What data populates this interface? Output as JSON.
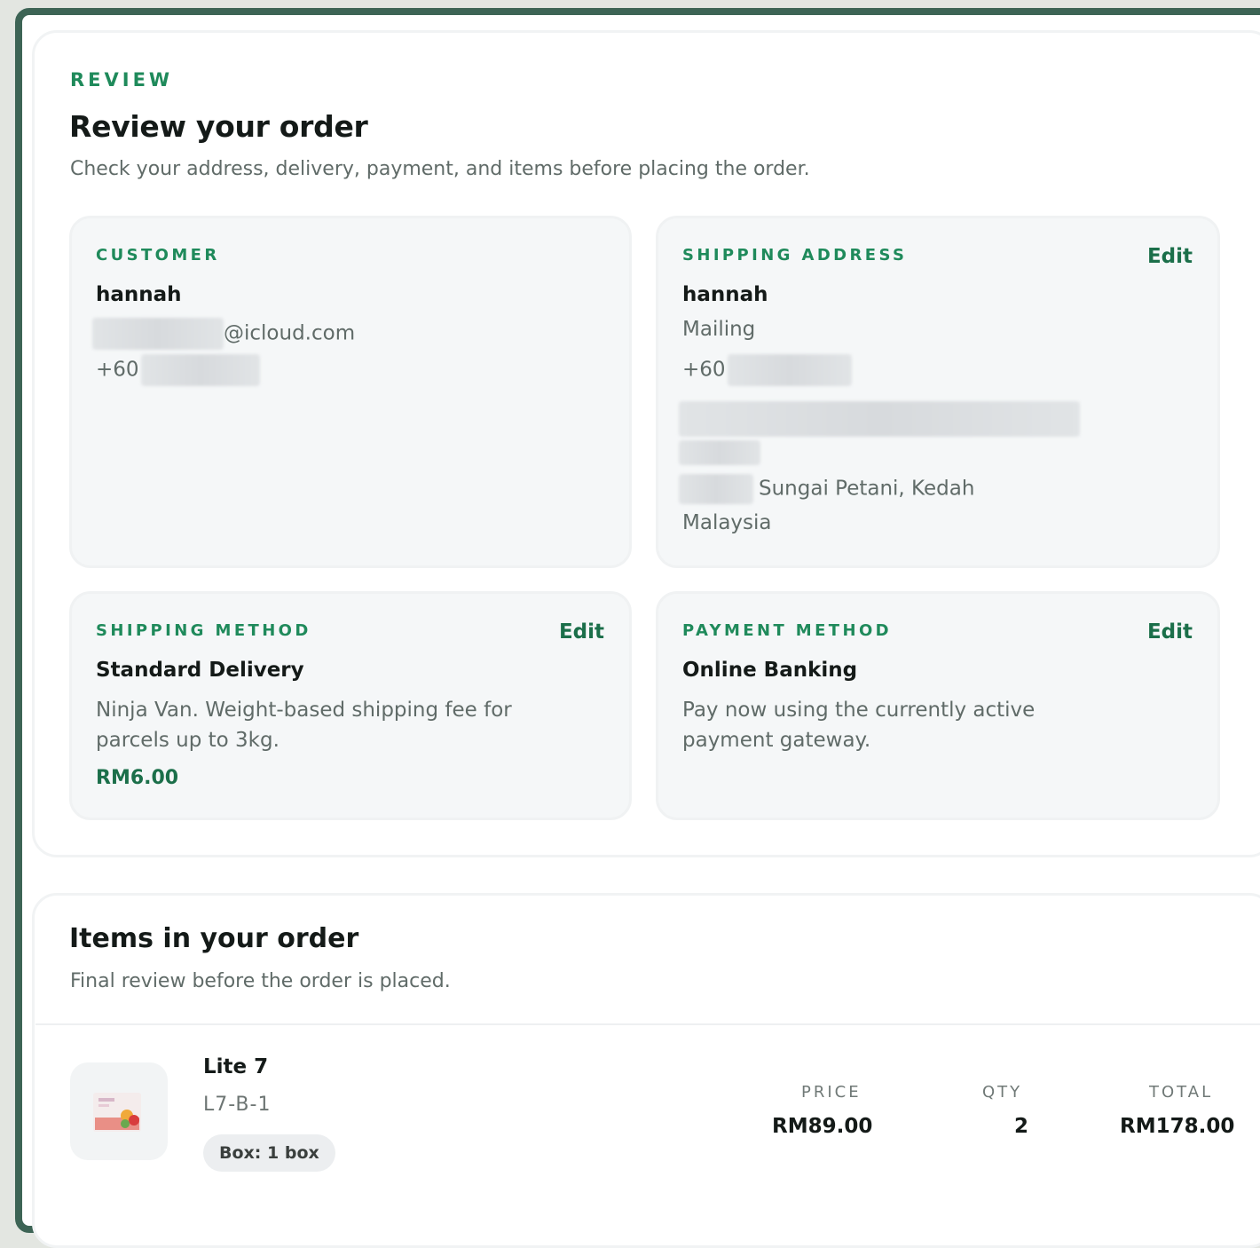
{
  "review": {
    "eyebrow": "REVIEW",
    "title": "Review your order",
    "subtitle": "Check your address, delivery, payment, and items before placing the order."
  },
  "customer": {
    "label": "CUSTOMER",
    "name": "hannah",
    "email_domain": "@icloud.com",
    "phone_prefix": "+60"
  },
  "shipping_address": {
    "label": "SHIPPING ADDRESS",
    "edit_label": "Edit",
    "name": "hannah",
    "type": "Mailing",
    "phone_prefix": "+60",
    "city_state": "Sungai Petani, Kedah",
    "country": "Malaysia"
  },
  "shipping_method": {
    "label": "SHIPPING METHOD",
    "edit_label": "Edit",
    "name": "Standard Delivery",
    "description": "Ninja Van. Weight-based shipping fee for parcels up to 3kg.",
    "price": "RM6.00"
  },
  "payment_method": {
    "label": "PAYMENT METHOD",
    "edit_label": "Edit",
    "name": "Online Banking",
    "description": "Pay now using the currently active payment gateway."
  },
  "items": {
    "title": "Items in your order",
    "subtitle": "Final review before the order is placed.",
    "columns": {
      "price": "PRICE",
      "qty": "QTY",
      "total": "TOTAL"
    },
    "rows": [
      {
        "name": "Lite 7",
        "sku": "L7-B-1",
        "badge": "Box: 1 box",
        "price": "RM89.00",
        "qty": "2",
        "total": "RM178.00"
      }
    ]
  },
  "colors": {
    "accent_green": "#1f8a5b",
    "frame_green": "#3d6455",
    "card_bg": "#f5f7f8"
  }
}
